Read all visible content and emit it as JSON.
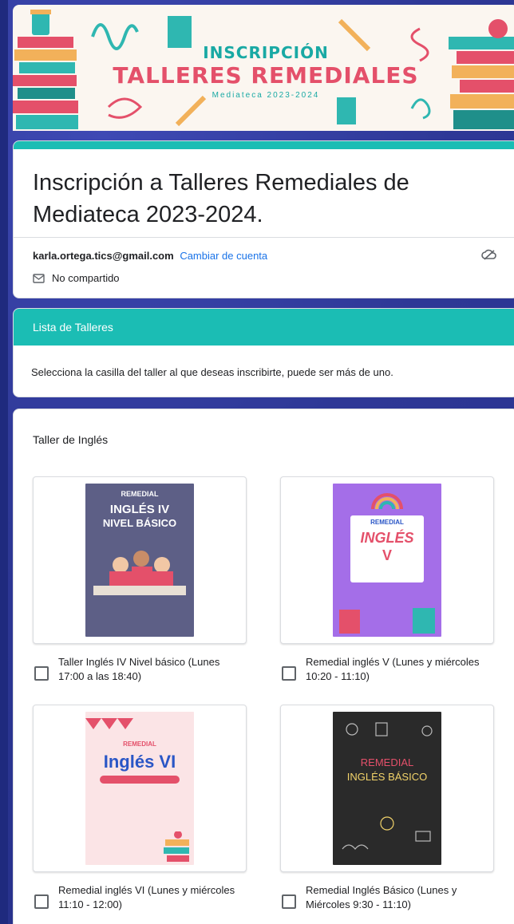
{
  "banner": {
    "line1": "INSCRIPCIÓN",
    "line2": "TALLERES REMEDIALES",
    "line3": "Mediateca 2023-2024"
  },
  "form": {
    "title": "Inscripción a Talleres Remediales de Mediateca 2023-2024.",
    "account_email": "karla.ortega.tics@gmail.com",
    "switch_account": "Cambiar de cuenta",
    "share_status": "No compartido"
  },
  "section": {
    "title": "Lista de Talleres",
    "description": "Selecciona la casilla del taller al que deseas inscribirte, puede ser más de uno."
  },
  "question": {
    "title": "Taller de Inglés",
    "options": [
      {
        "label": "Taller Inglés IV Nivel básico (Lunes 17:00 a las 18:40)",
        "poster": {
          "top": "REMEDIAL",
          "main": "INGLÉS IV",
          "sub": "NIVEL BÁSICO",
          "bg": "#5d5f86",
          "fg": "#ffffff"
        }
      },
      {
        "label": "Remedial inglés V (Lunes y miércoles 10:20 - 11:10)",
        "poster": {
          "top": "REMEDIAL",
          "main": "INGLÉS",
          "sub": "V",
          "bg": "#a46ee8",
          "fg": "#e4506a"
        }
      },
      {
        "label": "Remedial inglés VI (Lunes y miércoles 11:10 - 12:00)",
        "poster": {
          "top": "REMEDIAL",
          "main": "Inglés VI",
          "sub": "",
          "bg": "#fbe4e6",
          "fg": "#2a56c6"
        }
      },
      {
        "label": "Remedial Inglés Básico (Lunes y Miércoles 9:30 - 11:10)",
        "poster": {
          "top": "REMEDIAL",
          "main": "INGLÉS BÁSICO",
          "sub": "",
          "bg": "#2a2a2a",
          "fg": "#f2d36a"
        }
      }
    ]
  }
}
